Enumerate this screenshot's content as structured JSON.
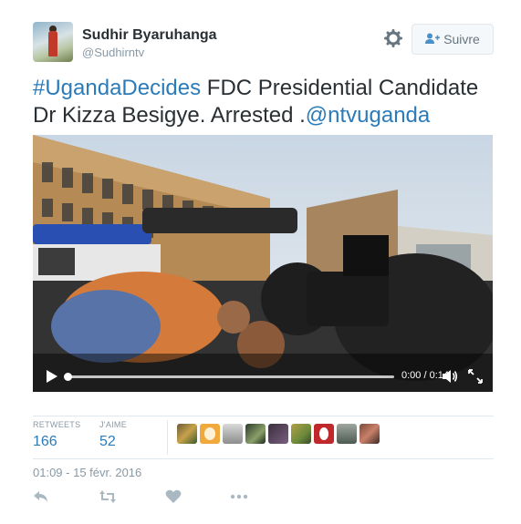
{
  "user": {
    "name": "Sudhir Byaruhanga",
    "handle": "@Sudhirntv",
    "follow_label": "Suivre"
  },
  "tweet": {
    "hashtag": "#UgandaDecides",
    "text_part": " FDC Presidential Candidate Dr Kizza Besigye. Arrested .",
    "mention": "@ntvuganda"
  },
  "video": {
    "timecode": "0:00 / 0:14",
    "progress": 0
  },
  "stats": {
    "retweets_label": "RETWEETS",
    "retweets_value": "166",
    "likes_label": "J'AIME",
    "likes_value": "52"
  },
  "timestamp": "01:09 - 15 févr. 2016",
  "icons": {
    "settings": "gear-icon",
    "follow": "add-user-icon",
    "reply": "reply-icon",
    "retweet": "retweet-icon",
    "like": "heart-icon",
    "more": "more-icon"
  },
  "colors": {
    "link": "#2b7bb9",
    "muted": "#8899a6",
    "text": "#292f33"
  }
}
